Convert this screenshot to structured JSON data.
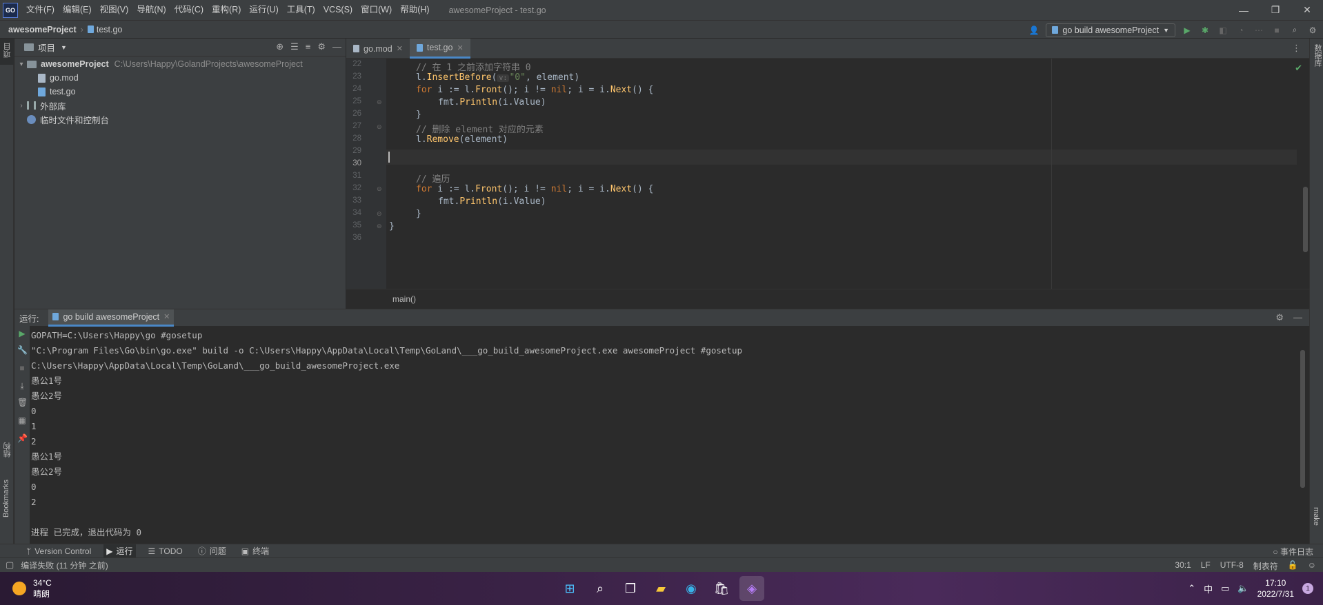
{
  "titlebar": {
    "logo": "GO",
    "menus": [
      "文件(F)",
      "编辑(E)",
      "视图(V)",
      "导航(N)",
      "代码(C)",
      "重构(R)",
      "运行(U)",
      "工具(T)",
      "VCS(S)",
      "窗口(W)",
      "帮助(H)"
    ],
    "window_title": "awesomeProject - test.go",
    "controls": {
      "minimize": "—",
      "maximize": "❐",
      "close": "✕"
    }
  },
  "navbar": {
    "project": "awesomeProject",
    "separator": "›",
    "file": "test.go",
    "run_config": "go build awesomeProject"
  },
  "left_strip": {
    "project_label": "项目",
    "structure_label": "结构",
    "bookmarks_label": "Bookmarks"
  },
  "right_strip": {
    "database_label": "数据库",
    "make_label": "make"
  },
  "project_panel": {
    "title": "项目",
    "root_name": "awesomeProject",
    "root_path": "C:\\Users\\Happy\\GolandProjects\\awesomeProject",
    "files": [
      "go.mod",
      "test.go"
    ],
    "external_libs": "外部库",
    "scratches": "临时文件和控制台"
  },
  "editor": {
    "tabs": [
      {
        "label": "go.mod",
        "active": false
      },
      {
        "label": "test.go",
        "active": true
      }
    ],
    "line_numbers": [
      "22",
      "23",
      "24",
      "25",
      "26",
      "27",
      "28",
      "29",
      "30",
      "31",
      "32",
      "33",
      "34",
      "35",
      "36"
    ],
    "current_line": "30",
    "code": {
      "l23": "// 在 1 之前添加字符串 0",
      "l24_a": "l.",
      "l24_fn": "InsertBefore",
      "l24_b": "(",
      "l24_hint": "v:",
      "l24_str": "\"0\"",
      "l24_c": ", element)",
      "l25_kw": "for",
      "l25_a": " i := l.",
      "l25_fn1": "Front",
      "l25_b": "(); i != ",
      "l25_nil": "nil",
      "l25_c": "; i = i.",
      "l25_fn2": "Next",
      "l25_d": "() {",
      "l26_a": "fmt.",
      "l26_fn": "Println",
      "l26_b": "(i.Value)",
      "l27": "}",
      "l28": "// 删除 element 对应的元素",
      "l29_a": "l.",
      "l29_fn": "Remove",
      "l29_b": "(element)",
      "l31": "// 遍历",
      "l32_kw": "for",
      "l32_a": " i := l.",
      "l32_fn1": "Front",
      "l32_b": "(); i != ",
      "l32_nil": "nil",
      "l32_c": "; i = i.",
      "l32_fn2": "Next",
      "l32_d": "() {",
      "l33_a": "fmt.",
      "l33_fn": "Println",
      "l33_b": "(i.Value)",
      "l34": "}",
      "l35": "}"
    },
    "function_breadcrumb": "main()"
  },
  "run_panel": {
    "label": "运行:",
    "tab": "go build awesomeProject",
    "console": [
      "GOPATH=C:\\Users\\Happy\\go #gosetup",
      "\"C:\\Program Files\\Go\\bin\\go.exe\" build -o C:\\Users\\Happy\\AppData\\Local\\Temp\\GoLand\\___go_build_awesomeProject.exe awesomeProject #gosetup",
      "C:\\Users\\Happy\\AppData\\Local\\Temp\\GoLand\\___go_build_awesomeProject.exe",
      "愚公1号",
      "愚公2号",
      "0",
      "1",
      "2",
      "愚公1号",
      "愚公2号",
      "0",
      "2",
      "",
      "进程 已完成，退出代码为 0"
    ]
  },
  "bottom_bar": {
    "tabs": [
      {
        "label": "Version Control",
        "active": false
      },
      {
        "label": "运行",
        "active": true
      },
      {
        "label": "TODO",
        "active": false
      },
      {
        "label": "问题",
        "active": false
      },
      {
        "label": "终端",
        "active": false
      }
    ],
    "event_log": "事件日志"
  },
  "status_bar": {
    "message": "编译失败 (11 分钟 之前)",
    "position": "30:1",
    "line_ending": "LF",
    "encoding": "UTF-8",
    "indent": "制表符"
  },
  "taskbar": {
    "temperature": "34°C",
    "weather": "晴朗",
    "ime": "中",
    "time": "17:10",
    "date": "2022/7/31",
    "notifications": "1"
  },
  "colors": {
    "accent": "#4a88c7",
    "keyword": "#cc7832",
    "function": "#ffc66d",
    "string": "#6a8759",
    "comment": "#808080"
  }
}
